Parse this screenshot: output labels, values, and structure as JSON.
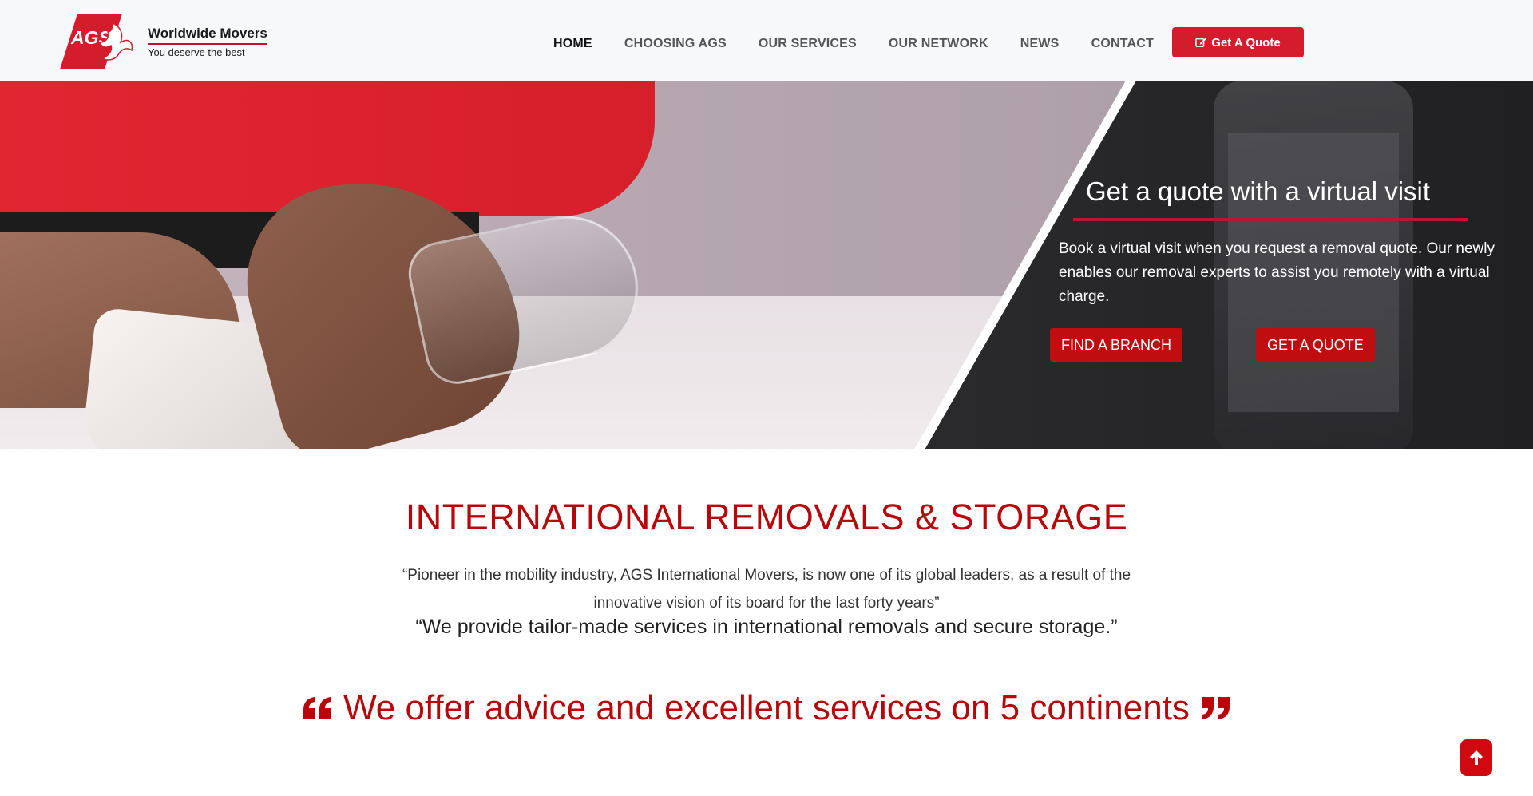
{
  "brand": {
    "logo_letters": "AGS",
    "name": "Worldwide Movers",
    "tagline": "You deserve the best"
  },
  "nav": {
    "items": [
      {
        "label": "HOME",
        "active": true
      },
      {
        "label": "CHOOSING AGS",
        "active": false
      },
      {
        "label": "OUR SERVICES",
        "active": false
      },
      {
        "label": "OUR NETWORK",
        "active": false
      },
      {
        "label": "NEWS",
        "active": false
      },
      {
        "label": "CONTACT",
        "active": false
      }
    ],
    "quote_button": "Get A Quote",
    "quote_icon": "edit-icon"
  },
  "hero": {
    "title": "Get a quote with a virtual visit",
    "description_lines": [
      "Book a virtual visit when you request a removal quote. Our newly",
      "enables our removal experts to assist you remotely with a virtual",
      "charge."
    ],
    "btn_branch": "FIND A BRANCH",
    "btn_quote": "GET A QUOTE"
  },
  "content": {
    "title": "INTERNATIONAL REMOVALS & STORAGE",
    "quote1": "“Pioneer in the mobility industry, AGS International Movers, is now one of its global leaders, as a result of the innovative vision of its board for the last forty years”",
    "quote2": "“We provide tailor-made services in international removals and secure storage.”",
    "tagline": "We offer advice and excellent services on 5 continents"
  },
  "scroll_top_icon": "arrow-up-icon",
  "colors": {
    "brand_red": "#d41c2c",
    "title_red": "#b8070b",
    "button_red": "#c00d10",
    "hero_dark": "#2a2a2c"
  }
}
